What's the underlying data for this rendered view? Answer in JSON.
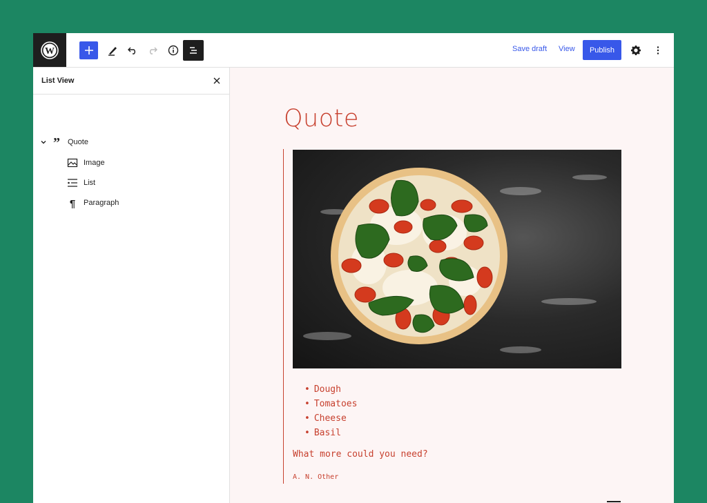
{
  "header": {
    "save_draft_label": "Save draft",
    "view_label": "View",
    "publish_label": "Publish",
    "icons": [
      "wordpress-logo-icon",
      "plus-icon",
      "pencil-icon",
      "undo-icon",
      "redo-icon",
      "info-icon",
      "list-view-icon",
      "gear-icon",
      "more-vertical-icon"
    ]
  },
  "sidebar": {
    "title": "List View",
    "items": [
      {
        "label": "Quote",
        "icon": "quote-icon",
        "expanded": true
      },
      {
        "label": "Image",
        "icon": "image-icon"
      },
      {
        "label": "List",
        "icon": "list-icon"
      },
      {
        "label": "Paragraph",
        "icon": "paragraph-icon"
      }
    ]
  },
  "canvas": {
    "title": "Quote",
    "list_items": [
      "Dough",
      "Tomatoes",
      "Cheese",
      "Basil"
    ],
    "paragraph": "What more could you need?",
    "citation": "A. N. Other"
  },
  "colors": {
    "background": "#1c8662",
    "accent": "#3858e9",
    "text_accent": "#c7402e",
    "canvas_bg": "#fdf5f5",
    "toolbar_dark": "#1e1e1e"
  }
}
